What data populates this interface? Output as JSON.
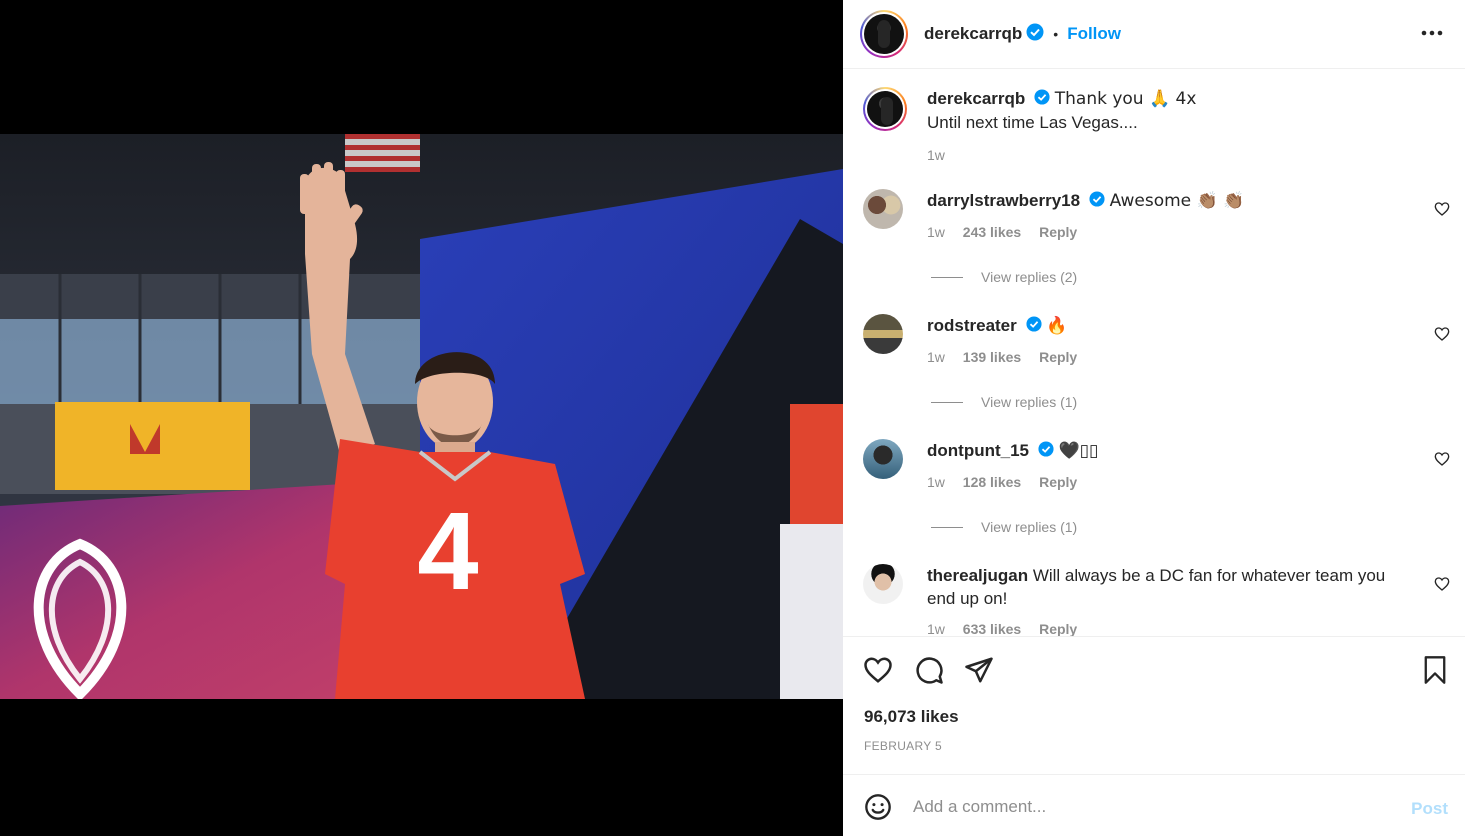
{
  "post": {
    "author": "derekcarrqb",
    "follow_label": "Follow",
    "more_label": "•••",
    "caption_line1": "Thank you 🙏 4x",
    "caption_line2": "Until next time Las Vegas....",
    "caption_time": "1w",
    "jersey_number": "4"
  },
  "comments": [
    {
      "user": "darrylstrawberry18",
      "verified": true,
      "text": "Awesome 👏🏽 👏🏽",
      "time": "1w",
      "likes": "243 likes",
      "reply": "Reply",
      "view_replies": "View replies (2)"
    },
    {
      "user": "rodstreater",
      "verified": true,
      "text": "🔥",
      "time": "1w",
      "likes": "139 likes",
      "reply": "Reply",
      "view_replies": "View replies (1)"
    },
    {
      "user": "dontpunt_15",
      "verified": true,
      "text": "🖤▯▯",
      "time": "1w",
      "likes": "128 likes",
      "reply": "Reply",
      "view_replies": "View replies (1)"
    },
    {
      "user": "therealjugan",
      "verified": false,
      "text": "Will always be a DC fan for whatever team you end up on!",
      "time": "1w",
      "likes": "633 likes",
      "reply": "Reply"
    }
  ],
  "stats": {
    "likes": "96,073 likes",
    "date": "FEBRUARY 5"
  },
  "add_comment": {
    "placeholder": "Add a comment...",
    "post_label": "Post"
  },
  "colors": {
    "accent": "#0095f6",
    "post_disabled": "#b2dffc",
    "meta": "#8e8e8e",
    "jersey": "#e8402f"
  },
  "icons": [
    "verified-badge-icon",
    "more-options-icon",
    "heart-icon",
    "comment-icon",
    "share-icon",
    "save-icon",
    "emoji-icon"
  ]
}
